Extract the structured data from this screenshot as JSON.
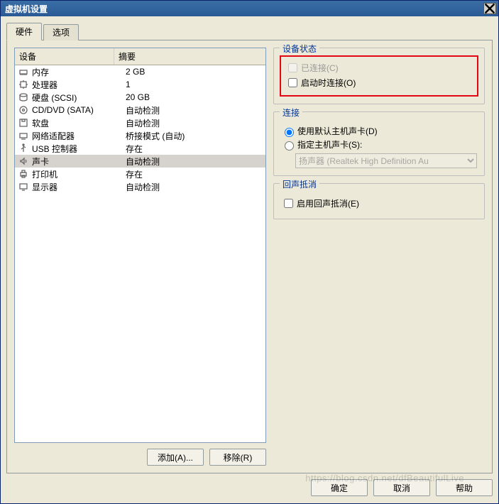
{
  "window": {
    "title": "虚拟机设置"
  },
  "tabs": {
    "hardware": "硬件",
    "options": "选项"
  },
  "list": {
    "headers": {
      "device": "设备",
      "summary": "摘要"
    },
    "items": [
      {
        "icon": "memory",
        "device": "内存",
        "summary": "2 GB"
      },
      {
        "icon": "cpu",
        "device": "处理器",
        "summary": "1"
      },
      {
        "icon": "disk",
        "device": "硬盘 (SCSI)",
        "summary": "20 GB"
      },
      {
        "icon": "cd",
        "device": "CD/DVD (SATA)",
        "summary": "自动检测"
      },
      {
        "icon": "floppy",
        "device": "软盘",
        "summary": "自动检测"
      },
      {
        "icon": "net",
        "device": "网络适配器",
        "summary": "桥接模式 (自动)"
      },
      {
        "icon": "usb",
        "device": "USB 控制器",
        "summary": "存在"
      },
      {
        "icon": "sound",
        "device": "声卡",
        "summary": "自动检测",
        "selected": true
      },
      {
        "icon": "printer",
        "device": "打印机",
        "summary": "存在"
      },
      {
        "icon": "display",
        "device": "显示器",
        "summary": "自动检测"
      }
    ]
  },
  "leftButtons": {
    "add": "添加(A)...",
    "remove": "移除(R)"
  },
  "groups": {
    "status": {
      "title": "设备状态",
      "connected": "已连接(C)",
      "connectAtPower": "启动时连接(O)"
    },
    "connection": {
      "title": "连接",
      "useDefault": "使用默认主机声卡(D)",
      "specify": "指定主机声卡(S):",
      "dropdownValue": "扬声器 (Realtek High Definition Au"
    },
    "echo": {
      "title": "回声抵消",
      "enable": "启用回声抵消(E)"
    }
  },
  "footer": {
    "ok": "确定",
    "cancel": "取消",
    "help": "帮助"
  },
  "watermark": "https://blog.csdn.net/dfBeautifulLive"
}
